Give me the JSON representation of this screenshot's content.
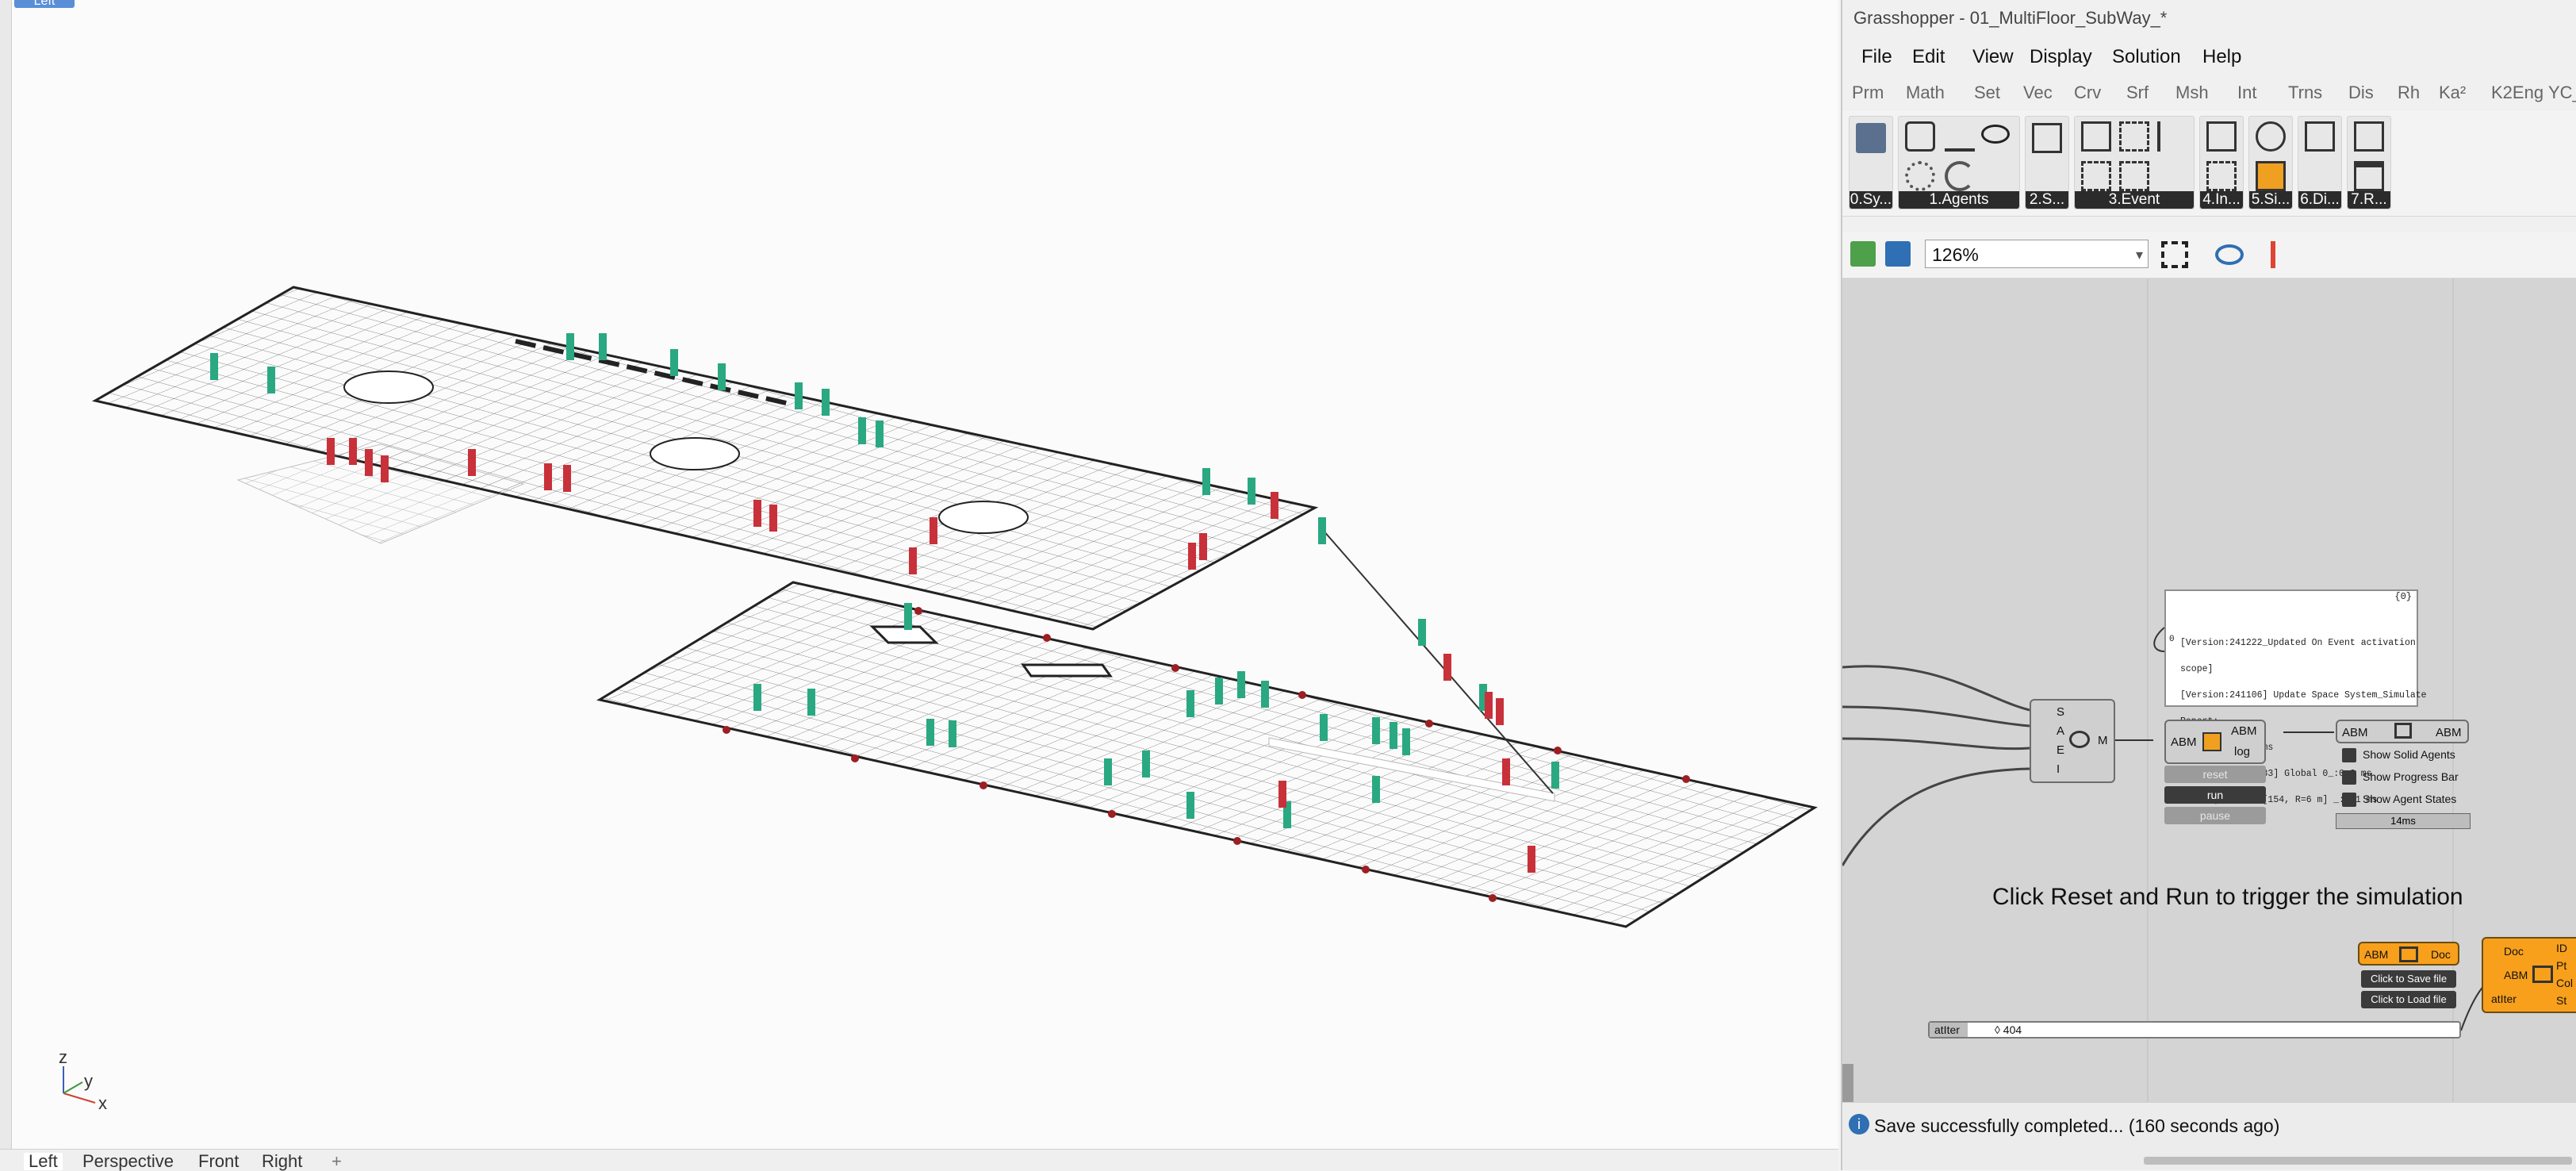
{
  "viewport": {
    "active_label": "Left",
    "tabs": [
      "Left",
      "Perspective",
      "Front",
      "Right"
    ],
    "add_tab": "+",
    "axes": {
      "x": "x",
      "y": "y",
      "z": "z"
    }
  },
  "gh": {
    "title": "Grasshopper - 01_MultiFloor_SubWay_*",
    "menu": [
      "File",
      "Edit",
      "View",
      "Display",
      "Solution",
      "Help"
    ],
    "tabs": [
      "Prm",
      "Math",
      "Set",
      "Vec",
      "Crv",
      "Srf",
      "Msh",
      "Int",
      "Trns",
      "Dis",
      "Rh",
      "Ka²",
      "K2Eng",
      "YC_"
    ],
    "ribbon_groups": [
      "0.Sy...",
      "1.Agents",
      "2.S...",
      "3.Event",
      "4.In...",
      "5.Si...",
      "6.Di...",
      "7.R..."
    ],
    "zoom": "126%",
    "status": "Save successfully completed... (160 seconds ago)",
    "hint": "Click Reset and Run to trigger the simulation",
    "nodes": {
      "sim_inputs": [
        "S",
        "A",
        "E",
        "I"
      ],
      "sim_output": "M",
      "engine_in": "ABM",
      "engine_out_top": "ABM",
      "engine_out_bottom": "log",
      "btn_reset": "reset",
      "btn_run": "run",
      "btn_pause": "pause",
      "display_in": "ABM",
      "display_out": "ABM",
      "options": [
        "Show Solid Agents",
        "Show Progress Bar",
        "Show Agent States"
      ],
      "time": "14ms",
      "file_in": "ABM",
      "file_out": "Doc",
      "save_btn": "Click to Save file",
      "load_btn": "Click to Load file",
      "export_in": [
        "Doc",
        "ABM",
        "atIter"
      ],
      "export_out": [
        "ID",
        "Pt",
        "Col",
        "St"
      ],
      "panel_index": "{0}",
      "panel_prefix": "0",
      "panel_lines": [
        "[Version:241222_Updated On Event activation",
        "scope]",
        "[Version:241106] Update Space System_Simulate",
        "Report:",
        "Decisions_:2.6 ms",
        "Person|Pois: [283] Global 0_:0.2 ms",
        "Person|Person: [154, R=6 m] _:0.1 ms"
      ],
      "slider_label": "atIter",
      "slider_value": "◊ 404"
    }
  },
  "colors": {
    "teal": "#2aa882",
    "red": "#c8313a",
    "orange": "#f8a01c",
    "accent": "#5a8fd8"
  }
}
